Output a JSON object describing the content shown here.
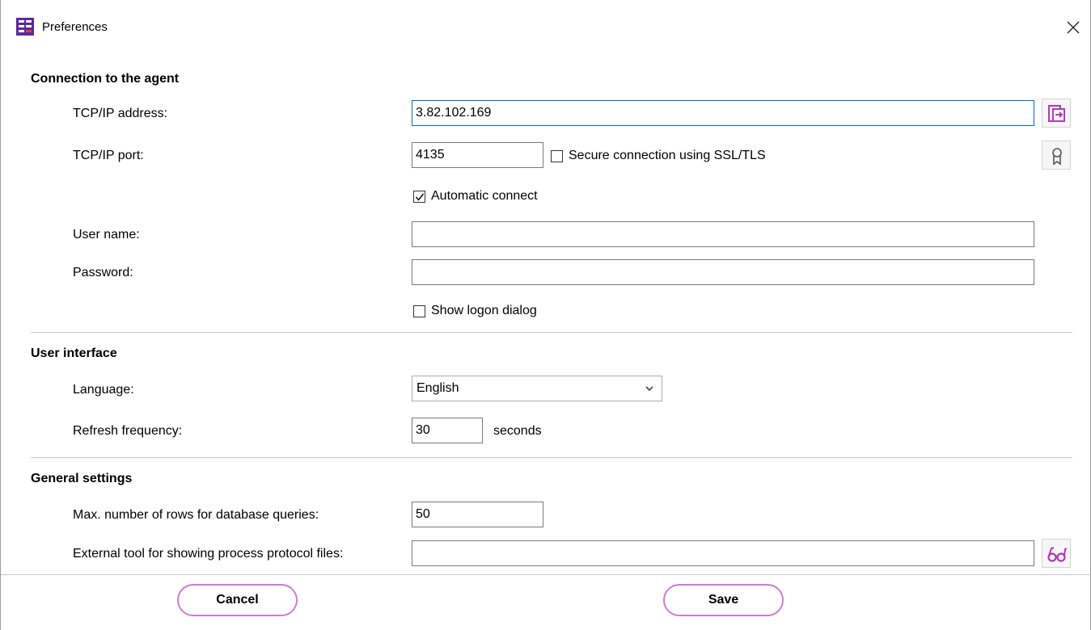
{
  "window": {
    "title": "Preferences",
    "app_icon": "app-grid-icon",
    "close_icon": "close-icon"
  },
  "connection": {
    "section_title": "Connection to the agent",
    "tcp_address_label": "TCP/IP address:",
    "tcp_address_value": "3.82.102.169",
    "tcp_port_label": "TCP/IP port:",
    "tcp_port_value": "4135",
    "ssl_label": "Secure connection using SSL/TLS",
    "ssl_checked": false,
    "auto_connect_label": "Automatic connect",
    "auto_connect_checked": true,
    "user_name_label": "User name:",
    "user_name_value": "",
    "password_label": "Password:",
    "password_value": "",
    "show_logon_label": "Show logon dialog",
    "show_logon_checked": false,
    "address_button_icon": "connect-icon",
    "certificate_button_icon": "certificate-icon"
  },
  "user_interface": {
    "section_title": "User interface",
    "language_label": "Language:",
    "language_value": "English",
    "refresh_label": "Refresh frequency:",
    "refresh_value": "30",
    "refresh_unit": "seconds"
  },
  "general": {
    "section_title": "General settings",
    "max_rows_label": "Max. number of rows for database queries:",
    "max_rows_value": "50",
    "external_tool_label": "External tool for showing process protocol files:",
    "external_tool_value": "",
    "browse_button_icon": "browse-glasses-icon"
  },
  "buttons": {
    "cancel": "Cancel",
    "save": "Save"
  },
  "colors": {
    "accent": "#cf7ad4",
    "icon_purple": "#b03ab8",
    "focus_border": "#0a64c8"
  }
}
